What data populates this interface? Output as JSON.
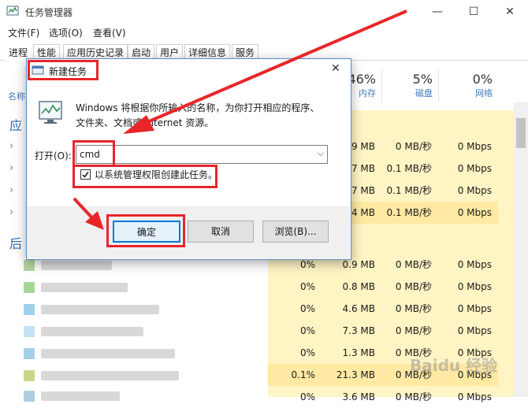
{
  "task_manager": {
    "title": "任务管理器",
    "menu": [
      "文件(F)",
      "选项(O)",
      "查看(V)"
    ],
    "tabs": [
      "进程",
      "性能",
      "应用历史记录",
      "启动",
      "用户",
      "详细信息",
      "服务"
    ],
    "left_fragments": {
      "name_col": "名称",
      "group_apps": "应",
      "group_bg": "后"
    },
    "columns": {
      "memory": {
        "percent": "46%",
        "label": "内存"
      },
      "disk": {
        "percent": "5%",
        "label": "磁盘"
      },
      "network": {
        "percent": "0%",
        "label": "网络"
      }
    },
    "rows_top": [
      {
        "memory": "9 MB",
        "disk": "0 MB/秒",
        "network": "0 Mbps"
      },
      {
        "memory": "7 MB",
        "disk": "0.1 MB/秒",
        "network": "0 Mbps"
      },
      {
        "memory": "7 MB",
        "disk": "0.1 MB/秒",
        "network": "0 Mbps"
      },
      {
        "memory": "4 MB",
        "disk": "0.1 MB/秒",
        "network": "0 Mbps"
      }
    ],
    "rows_bottom": [
      {
        "cpu": "0%",
        "memory": "0.9 MB",
        "disk": "0 MB/秒",
        "network": "0 Mbps"
      },
      {
        "cpu": "0%",
        "memory": "0.8 MB",
        "disk": "0 MB/秒",
        "network": "0 Mbps"
      },
      {
        "cpu": "0%",
        "memory": "4.6 MB",
        "disk": "0 MB/秒",
        "network": "0 Mbps"
      },
      {
        "cpu": "0%",
        "memory": "7.3 MB",
        "disk": "0 MB/秒",
        "network": "0 Mbps"
      },
      {
        "cpu": "0%",
        "memory": "1.3 MB",
        "disk": "0 MB/秒",
        "network": "0 Mbps"
      },
      {
        "cpu": "0.1%",
        "memory": "21.3 MB",
        "disk": "0 MB/秒",
        "network": "0 Mbps"
      },
      {
        "cpu": "0%",
        "memory": "3.6 MB",
        "disk": "0 MB/秒",
        "network": "0 Mbps"
      }
    ],
    "window_buttons": {
      "minimize": "—",
      "maximize": "☐",
      "close": "✕"
    }
  },
  "dialog": {
    "title": "新建任务",
    "description_line1": "Windows 将根据你所输入的名称，为你打开相应的程序、",
    "description_line2": "文件夹、文档或 Internet 资源。",
    "open_label": "打开(O):",
    "open_value": "cmd",
    "admin_checkbox_label": "以系统管理权限创建此任务。",
    "admin_checked": true,
    "ok_label": "确定",
    "cancel_label": "取消",
    "browse_label": "浏览(B)...",
    "close_glyph": "✕"
  },
  "watermark": "Baidu 经验",
  "colors": {
    "highlight": "#fff4c4",
    "annotation_red": "#e8262a",
    "accent_blue": "#0078d7"
  }
}
